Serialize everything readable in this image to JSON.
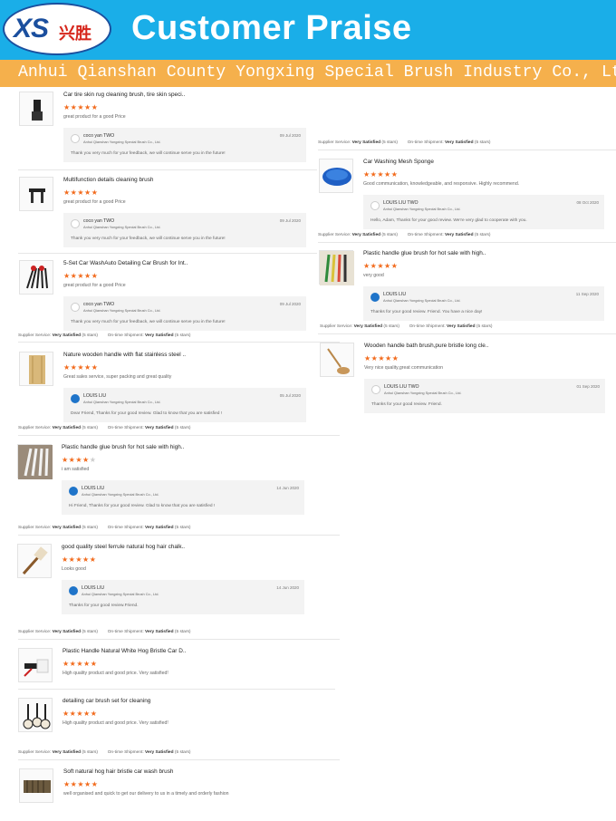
{
  "header": {
    "logo_text": "XS",
    "logo_cn": "兴胜",
    "title": "Customer Praise",
    "company": "Anhui Qianshan County Yongxing Special Brush Industry Co., Ltd.",
    "header_color": "#1aaee8",
    "company_bar_color": "#f5b04c"
  },
  "labels": {
    "supplier_service": "Supplier Service:",
    "on_time_shipment": "On-time Shipment:",
    "very_satisfied": "Very Satisfied",
    "five_stars": "(5 stars)"
  },
  "left_reviews": [
    {
      "title": "Car tire skin rug cleaning brush, tire skin speci..",
      "rating": 5,
      "comment": "great product for a good Price",
      "reply": {
        "name": "coco yan TWO",
        "company": "Anhui Qianshan Yongxing Special Brush Co., Ltd.",
        "date": "09 Jul 2020",
        "text": "Thank you very much for your feedback, we will continue serve you in the future!"
      }
    },
    {
      "title": "Multifunction details cleaning brush",
      "rating": 5,
      "comment": "great product for a good Price",
      "reply": {
        "name": "coco yan TWO",
        "company": "Anhui Qianshan Yongxing Special Brush Co., Ltd.",
        "date": "09 Jul 2020",
        "text": "Thank you very much for your feedback, we will continue serve you in the future!"
      }
    },
    {
      "title": "5-Set Car WashAuto Detailing Car Brush for Int..",
      "rating": 5,
      "comment": "great product for a good Price",
      "reply": {
        "name": "coco yan TWO",
        "company": "Anhui Qianshan Yongxing Special Brush Co., Ltd.",
        "date": "09 Jul 2020",
        "text": "Thank you very much for your feedback, we will continue serve you in the future!"
      }
    },
    {
      "title": "Nature wooden handle with flat stainless steel ..",
      "rating": 5,
      "comment": "Great sales service, super packing and great quality",
      "reply": {
        "name": "LOUIS LIU",
        "company": "Anhui Qianshan Yongxing Special Brush Co., Ltd.",
        "date": "05 Jul 2020",
        "text": "Dear Friend, Thanks for your good review. Glad to know that you are satisfied !"
      }
    },
    {
      "title": "Plastic handle glue brush for hot sale with high..",
      "rating": 4,
      "comment": "i am satisfied",
      "reply": {
        "name": "LOUIS LIU",
        "company": "Anhui Qianshan Yongxing Special Brush Co., Ltd.",
        "date": "14 Jun 2020",
        "text": "Hi Friend, Thanks for your good review. Glad to know that you are satisfied !"
      }
    },
    {
      "title": "good quality steel ferrule natural hog hair chalk..",
      "rating": 5,
      "comment": "Looks good",
      "reply": {
        "name": "LOUIS LIU",
        "company": "Anhui Qianshan Yongxing Special Brush Co., Ltd.",
        "date": "14 Jun 2020",
        "text": "Thanks for your good review.Friend."
      }
    },
    {
      "title": "Plastic Handle Natural White Hog Bristle Car D..",
      "rating": 5,
      "comment": "High quality product and good price. Very satisfied!",
      "reply": null
    },
    {
      "title": "detailing car brush set for cleaning",
      "rating": 5,
      "comment": "High quality product and good price. Very satisfied!",
      "reply": null
    },
    {
      "title": "Soft natural hog hair bristle car wash brush",
      "rating": 5,
      "comment": "well organised and quick to get our delivery to us in a timely and orderly fashion",
      "reply": null
    }
  ],
  "right_reviews": [
    {
      "title": "Car Washing Mesh Sponge",
      "rating": 5,
      "comment": "Good communication, knowledgeable, and responsive. Highly recommend.",
      "reply": {
        "name": "LOUIS LIU TWO",
        "company": "Anhui Qianshan Yongxing Special Brush Co., Ltd.",
        "date": "08 Oct 2020",
        "text": "Hello, Adam, Thanks for your good review. We're very glad to cooperate with you."
      }
    },
    {
      "title": "Plastic handle glue brush for hot sale with high..",
      "rating": 5,
      "comment": "very good",
      "reply": {
        "name": "LOUIS LIU",
        "company": "Anhui Qianshan Yongxing Special Brush Co., Ltd.",
        "date": "11 Sep 2020",
        "text": "Thanks for your good review. Friend. You have a nice day!"
      }
    },
    {
      "title": "Wooden handle bath brush,pure bristle long cle..",
      "rating": 5,
      "comment": "Very nice quality,great communication",
      "reply": {
        "name": "LOUIS LIU TWO",
        "company": "Anhui Qianshan Yongxing Special Brush Co., Ltd.",
        "date": "01 Sep 2020",
        "text": "Thanks for your good review. Friend."
      }
    }
  ]
}
